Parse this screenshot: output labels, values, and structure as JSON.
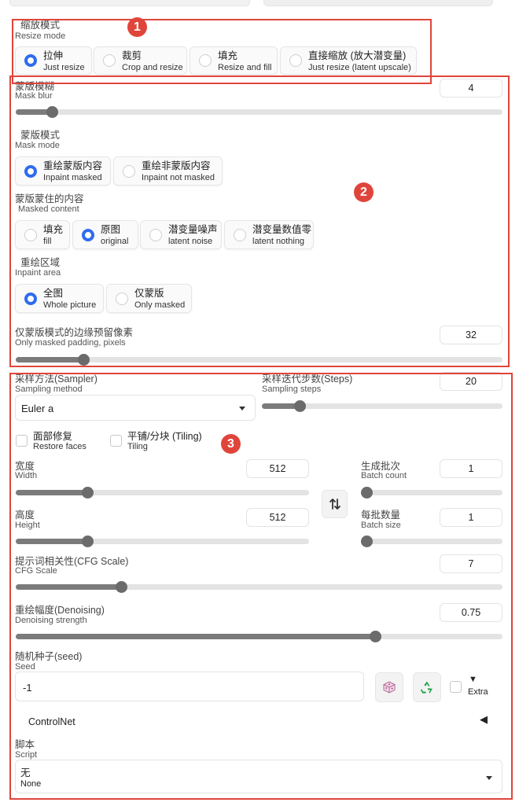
{
  "resize_mode": {
    "label_zh": "缩放模式",
    "label_en": "Resize mode",
    "options": [
      {
        "zh": "拉伸",
        "en": "Just resize",
        "selected": true
      },
      {
        "zh": "裁剪",
        "en": "Crop and resize",
        "selected": false
      },
      {
        "zh": "填充",
        "en": "Resize and fill",
        "selected": false
      },
      {
        "zh": "直接缩放 (放大潜变量)",
        "en": "Just resize (latent upscale)",
        "selected": false
      }
    ]
  },
  "mask_blur": {
    "label_zh": "蒙版模糊",
    "label_en": "Mask blur",
    "value": "4",
    "slider_fraction": 0.064
  },
  "mask_mode": {
    "label_zh": "蒙版模式",
    "label_en": "Mask mode",
    "options": [
      {
        "zh": "重绘蒙版内容",
        "en": "Inpaint masked",
        "selected": true
      },
      {
        "zh": "重绘非蒙版内容",
        "en": "Inpaint not masked",
        "selected": false
      }
    ]
  },
  "masked_content": {
    "label_zh": "蒙版蒙住的内容",
    "label_en": "Masked content",
    "options": [
      {
        "zh": "填充",
        "en": "fill",
        "selected": false
      },
      {
        "zh": "原图",
        "en": "original",
        "selected": true
      },
      {
        "zh": "潜变量噪声",
        "en": "latent noise",
        "selected": false
      },
      {
        "zh": "潜变量数值零",
        "en": "latent nothing",
        "selected": false
      }
    ]
  },
  "inpaint_area": {
    "label_zh": "重绘区域",
    "label_en": "Inpaint area",
    "options": [
      {
        "zh": "全图",
        "en": "Whole picture",
        "selected": true
      },
      {
        "zh": "仅蒙版",
        "en": "Only masked",
        "selected": false
      }
    ]
  },
  "only_masked_padding": {
    "label_zh": "仅蒙版模式的边缘预留像素",
    "label_en": "Only masked padding, pixels",
    "value": "32",
    "slider_fraction": 0.13
  },
  "sampler": {
    "label_zh": "采样方法(Sampler)",
    "label_en": "Sampling method",
    "value": "Euler a"
  },
  "steps": {
    "label_zh": "采样迭代步数(Steps)",
    "label_en": "Sampling steps",
    "value": "20",
    "slider_fraction": 0.14
  },
  "restore_faces": {
    "label_zh": "面部修复",
    "label_en": "Restore faces",
    "checked": false
  },
  "tiling": {
    "label_zh": "平铺/分块 (Tiling)",
    "label_en": "Tiling",
    "checked": false
  },
  "width": {
    "label_zh": "宽度",
    "label_en": "Width",
    "value": "512",
    "slider_fraction": 0.235
  },
  "height": {
    "label_zh": "高度",
    "label_en": "Height",
    "value": "512",
    "slider_fraction": 0.235
  },
  "batch_count": {
    "label_zh": "生成批次",
    "label_en": "Batch count",
    "value": "1",
    "slider_fraction": 0.0
  },
  "batch_size": {
    "label_zh": "每批数量",
    "label_en": "Batch size",
    "value": "1",
    "slider_fraction": 0.0
  },
  "cfg_scale": {
    "label_zh": "提示词相关性(CFG Scale)",
    "label_en": "CFG Scale",
    "value": "7",
    "slider_fraction": 0.21
  },
  "denoising": {
    "label_zh": "重绘幅度(Denoising)",
    "label_en": "Denoising strength",
    "value": "0.75",
    "slider_fraction": 0.745
  },
  "seed": {
    "label_zh": "随机种子(seed)",
    "label_en": "Seed",
    "value": "-1"
  },
  "extra": {
    "arrow": "▼",
    "label": "Extra",
    "checked": false
  },
  "controlnet": {
    "label": "ControlNet",
    "arrow": "◀"
  },
  "script": {
    "label_zh": "脚本",
    "label_en": "Script",
    "value_zh": "无",
    "value_en": "None"
  },
  "annotations": {
    "badge1": "1",
    "badge2": "2",
    "badge3": "3",
    "color": "#e0453b"
  },
  "accent_color": "#2f6bf0"
}
